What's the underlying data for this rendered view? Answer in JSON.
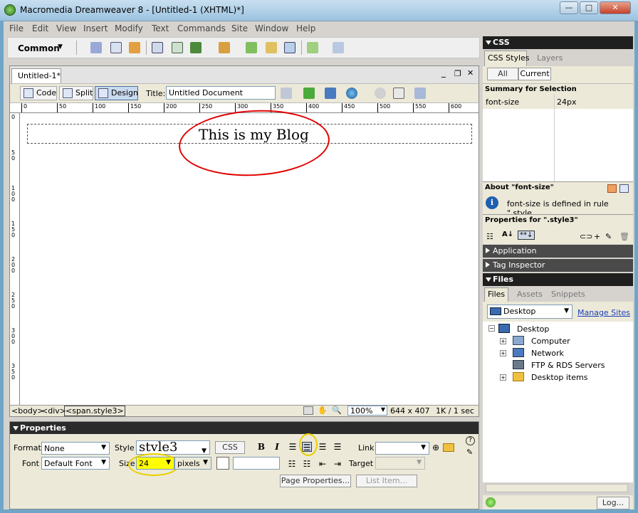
{
  "window": {
    "title": "Macromedia Dreamweaver 8 - [Untitled-1 (XHTML)*]",
    "min_label": "—",
    "max_label": "□",
    "close_label": "✕"
  },
  "menu": [
    "File",
    "Edit",
    "View",
    "Insert",
    "Modify",
    "Text",
    "Commands",
    "Site",
    "Window",
    "Help"
  ],
  "insert_bar": {
    "category": "Common"
  },
  "document": {
    "tab_label": "Untitled-1*",
    "view_code": "Code",
    "view_split": "Split",
    "view_design": "Design",
    "title_label": "Title:",
    "title_value": "Untitled Document",
    "ruler_h": [
      "0",
      "50",
      "100",
      "150",
      "200",
      "250",
      "300",
      "350",
      "400",
      "450",
      "500",
      "550",
      "600"
    ],
    "ruler_v": [
      "0",
      "50",
      "100",
      "150",
      "200",
      "250",
      "300",
      "350"
    ],
    "content_text": "This is my Blog",
    "tag_selector": [
      "<body>",
      "<div>",
      "<span.style3>"
    ],
    "zoom": "100%",
    "dimensions": "644 x 407",
    "download": "1K / 1 sec"
  },
  "properties": {
    "header": "Properties",
    "format_label": "Format",
    "format_value": "None",
    "style_label": "Style",
    "style_value": "stvle3",
    "css_button": "CSS",
    "bold": "B",
    "italic": "I",
    "link_label": "Link",
    "font_label": "Font",
    "font_value": "Default Font",
    "size_label": "Size",
    "size_value": "24",
    "unit_value": "pixels",
    "target_label": "Target",
    "page_properties": "Page Properties...",
    "list_item": "List Item..."
  },
  "css_panel": {
    "header": "CSS",
    "tab_styles": "CSS Styles",
    "tab_layers": "Layers",
    "btn_all": "All",
    "btn_current": "Current",
    "summary_title": "Summary for Selection",
    "prop_name": "font-size",
    "prop_value": "24px",
    "about_title": "About \"font-size\"",
    "about_text": "font-size is defined in rule \".style...",
    "props_for": "Properties for \".style3\""
  },
  "collapsed_panels": [
    "Application",
    "Tag Inspector"
  ],
  "files_panel": {
    "header": "Files",
    "tabs": [
      "Files",
      "Assets",
      "Snippets"
    ],
    "site_value": "Desktop",
    "manage_sites": "Manage Sites",
    "tree": [
      "Desktop",
      "Computer",
      "Network",
      "FTP & RDS Servers",
      "Desktop items"
    ],
    "log_button": "Log..."
  },
  "colors": {
    "annotation_red": "#e00000",
    "annotation_yellow": "#ffff00",
    "panel_header": "#1f1f1f"
  }
}
